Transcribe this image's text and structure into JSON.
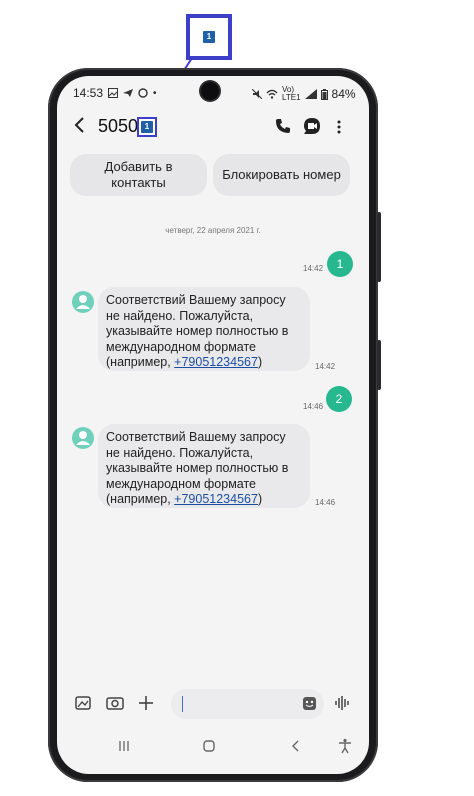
{
  "annotation": {
    "badge_label": "1",
    "small_badge_label": "1"
  },
  "status_bar": {
    "time": "14:53",
    "battery": "84%",
    "network_top": "Vo)",
    "network_bottom": "LTE1"
  },
  "header": {
    "title": "5050"
  },
  "actions": {
    "add_contact": "Добавить в контакты",
    "block_number": "Блокировать номер"
  },
  "conversation": {
    "date": "четверг, 22 апреля 2021 г.",
    "messages": [
      {
        "sent_label": "1",
        "sent_time": "14:42",
        "text": "Соответствий Вашему запросу не найдено. Пожалуйста, указывайте номер полностью в международном формате (например, ",
        "phone": "+79051234567",
        "suffix": ")",
        "time": "14:42"
      },
      {
        "sent_label": "2",
        "sent_time": "14:46",
        "text": "Соответствий Вашему запросу не найдено. Пожалуйста, указывайте номер полностью в международном формате (например, ",
        "phone": "+79051234567",
        "suffix": ")",
        "time": "14:46"
      }
    ]
  },
  "colors": {
    "accent": "#27b890",
    "avatar": "#6fd1bb",
    "annotation": "#3d3fc9",
    "link": "#1a4ea3"
  }
}
